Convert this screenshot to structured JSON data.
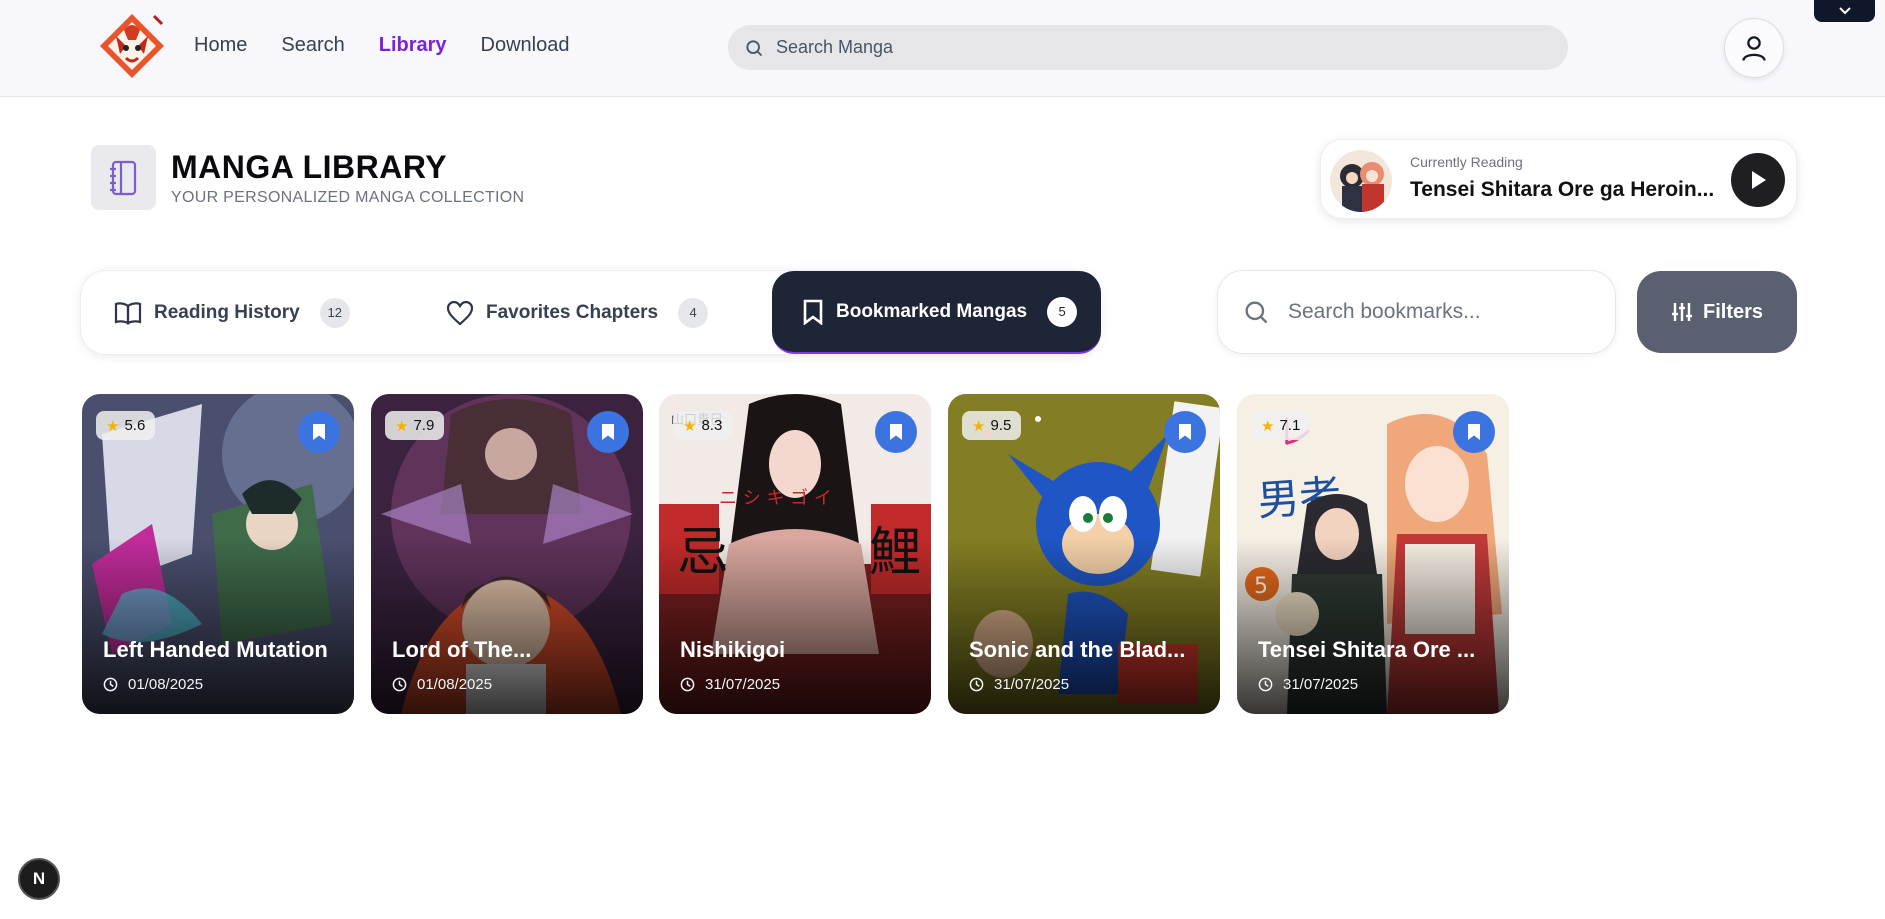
{
  "nav": {
    "links": [
      "Home",
      "Search",
      "Library",
      "Download"
    ],
    "active": "Library",
    "search_placeholder": "Search Manga",
    "accent_color": "#7c22d6"
  },
  "library": {
    "title": "MANGA LIBRARY",
    "subtitle": "YOUR PERSONALIZED MANGA COLLECTION"
  },
  "currently_reading": {
    "label": "Currently Reading",
    "title": "Tensei Shitara Ore ga Heroin..."
  },
  "tabs": [
    {
      "label": "Reading History",
      "count": "12",
      "icon": "book-open-icon"
    },
    {
      "label": "Favorites Chapters",
      "count": "4",
      "icon": "heart-icon"
    },
    {
      "label": "Bookmarked Mangas",
      "count": "5",
      "icon": "bookmark-icon",
      "active": true
    }
  ],
  "bookmarks_search": {
    "placeholder": "Search bookmarks..."
  },
  "filters_label": "Filters",
  "cards": [
    {
      "title": "Left Handed Mutation",
      "rating": "5.6",
      "date": "01/08/2025"
    },
    {
      "title": "Lord of The...",
      "rating": "7.9",
      "date": "01/08/2025"
    },
    {
      "title": "Nishikigoi",
      "rating": "8.3",
      "date": "31/07/2025"
    },
    {
      "title": "Sonic and the Blad...",
      "rating": "9.5",
      "date": "31/07/2025"
    },
    {
      "title": "Tensei Shitara Ore ...",
      "rating": "7.1",
      "date": "31/07/2025"
    }
  ],
  "dev_badge": "N"
}
